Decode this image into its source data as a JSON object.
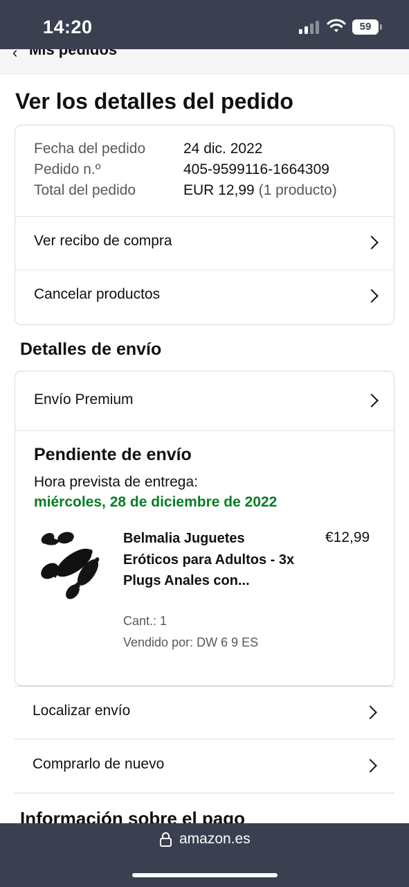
{
  "status_bar": {
    "time": "14:20",
    "battery": "59"
  },
  "nav": {
    "back_label": "Mis pedidos"
  },
  "page_title": "Ver los detalles del pedido",
  "order_summary": {
    "date_label": "Fecha del pedido",
    "date_value": "24 dic. 2022",
    "number_label": "Pedido n.º",
    "number_value": "405-9599116-1664309",
    "total_label": "Total del pedido",
    "total_value": "EUR 12,99",
    "total_count": "(1 producto)"
  },
  "order_actions": {
    "receipt": "Ver recibo de compra",
    "cancel": "Cancelar productos"
  },
  "shipping": {
    "section_title": "Detalles de envío",
    "method": "Envío Premium",
    "status_title": "Pendiente de envío",
    "eta_label": "Hora prevista de entrega:",
    "eta_date": "miércoles, 28 de diciembre de 2022",
    "product": {
      "title": "Belmalia Juguetes Eróticos para Adultos - 3x Plugs Anales con...",
      "price": "€12,99",
      "quantity": "Cant.: 1",
      "seller": "Vendido por: DW 6 9 ES"
    }
  },
  "shipment_actions": {
    "track": "Localizar envío",
    "buy_again": "Comprarlo de nuevo"
  },
  "payment": {
    "section_title": "Información sobre el pago"
  },
  "browser": {
    "url": "amazon.es"
  }
}
